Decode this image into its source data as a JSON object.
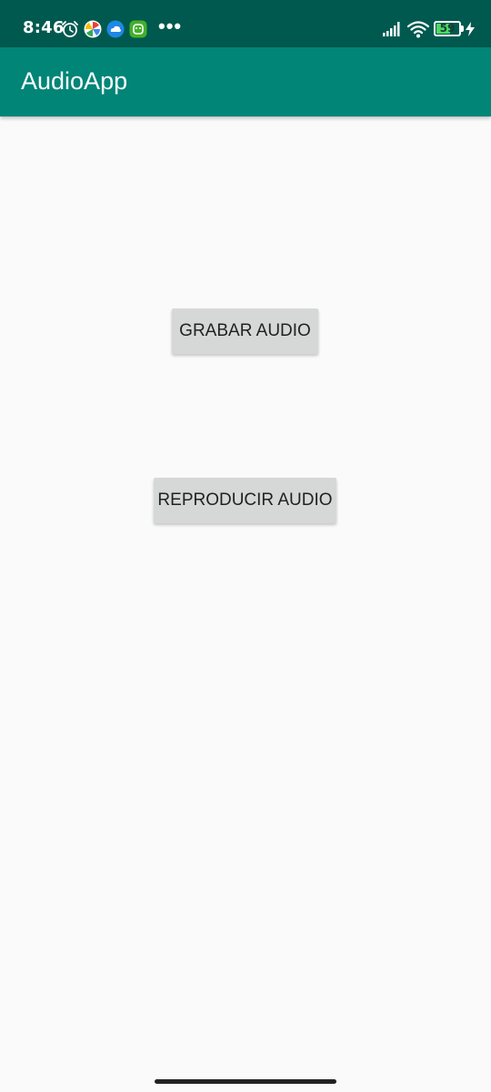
{
  "status_bar": {
    "time": "8:46",
    "notification_icons": [
      "alarm-icon",
      "pinwheel-icon",
      "cloud-icon",
      "android-icon"
    ],
    "overflow": "•••",
    "battery_level": "59",
    "battery_percent": 59,
    "background_color": "#00594f"
  },
  "app_bar": {
    "title": "AudioApp",
    "background_color": "#008577"
  },
  "main": {
    "record_button_label": "GRABAR AUDIO",
    "play_button_label": "REPRODUCIR AUDIO"
  }
}
